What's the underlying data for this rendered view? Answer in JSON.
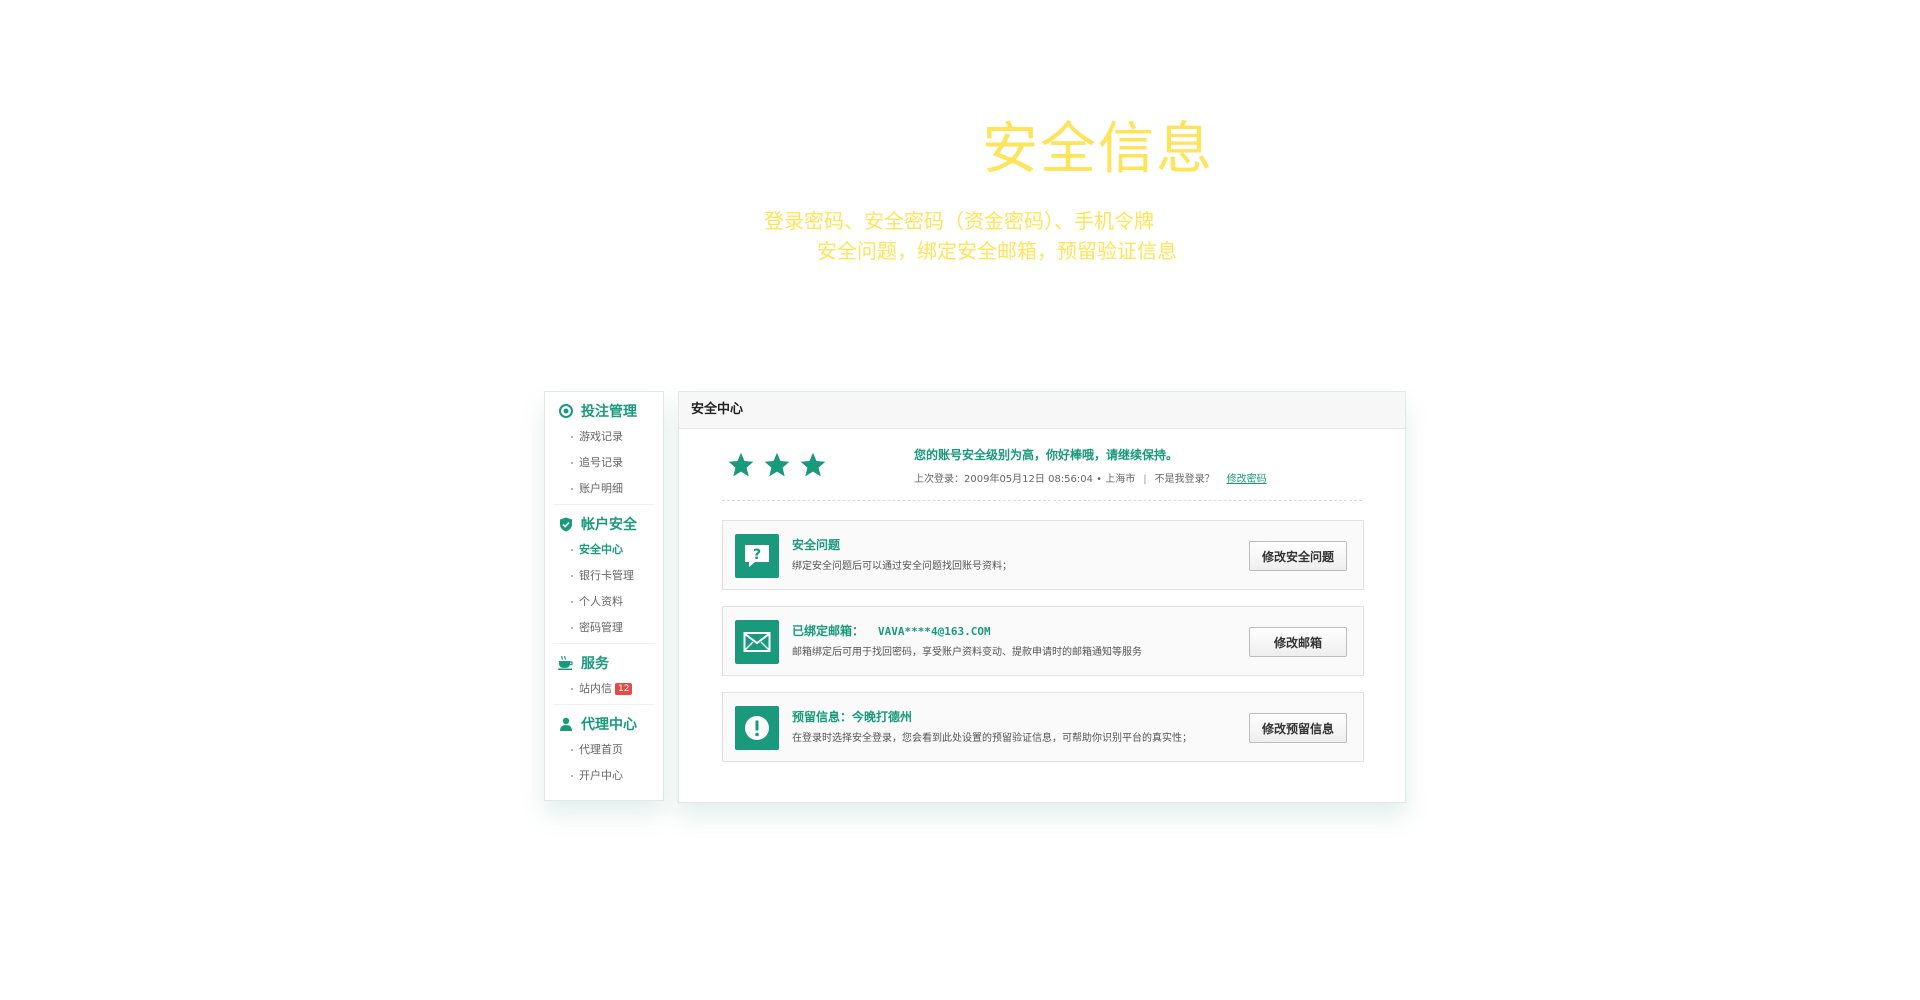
{
  "hero": {
    "title": "安全信息",
    "line1": "登录密码、安全密码（资金密码）、手机令牌",
    "line2": "安全问题，绑定安全邮箱，预留验证信息"
  },
  "colors": {
    "accent": "#1a9a7c",
    "hero_text": "#ffe45a",
    "badge": "#e64b45"
  },
  "sidebar": {
    "groups": [
      {
        "heading": "投注管理",
        "icon": "target-icon",
        "items": [
          {
            "label": "游戏记录"
          },
          {
            "label": "追号记录"
          },
          {
            "label": "账户明细"
          }
        ]
      },
      {
        "heading": "帐户安全",
        "icon": "shield-icon",
        "items": [
          {
            "label": "安全中心",
            "active": true
          },
          {
            "label": "银行卡管理"
          },
          {
            "label": "个人资料"
          },
          {
            "label": "密码管理"
          }
        ]
      },
      {
        "heading": "服务",
        "icon": "coffee-icon",
        "items": [
          {
            "label": "站内信",
            "badge": "12"
          }
        ]
      },
      {
        "heading": "代理中心",
        "icon": "user-icon",
        "items": [
          {
            "label": "代理首页"
          },
          {
            "label": "开户中心"
          }
        ]
      }
    ]
  },
  "main": {
    "header": "安全中心",
    "security_level_stars": 3,
    "message": "您的账号安全级别为高，你好棒哦，请继续保持。",
    "last_login_label": "上次登录：2009年05月12日 08:56:04 • 上海市",
    "separator": "|",
    "not_me": "不是我登录？",
    "change_password_link": "修改密码",
    "cards": [
      {
        "icon": "question-bubble-icon",
        "title": "安全问题",
        "email": "",
        "desc": "绑定安全问题后可以通过安全问题找回账号资料；",
        "button": "修改安全问题"
      },
      {
        "icon": "envelope-icon",
        "title": "已绑定邮箱：",
        "email": "VAVA****4@163.COM",
        "desc": "邮箱绑定后可用于找回密码，享受账户资料变动、提款申请时的邮箱通知等服务",
        "button": "修改邮箱"
      },
      {
        "icon": "exclamation-icon",
        "title": "预留信息：今晚打德州",
        "email": "",
        "desc": "在登录时选择安全登录，您会看到此处设置的预留验证信息，可帮助你识别平台的真实性；",
        "button": "修改预留信息"
      }
    ]
  }
}
